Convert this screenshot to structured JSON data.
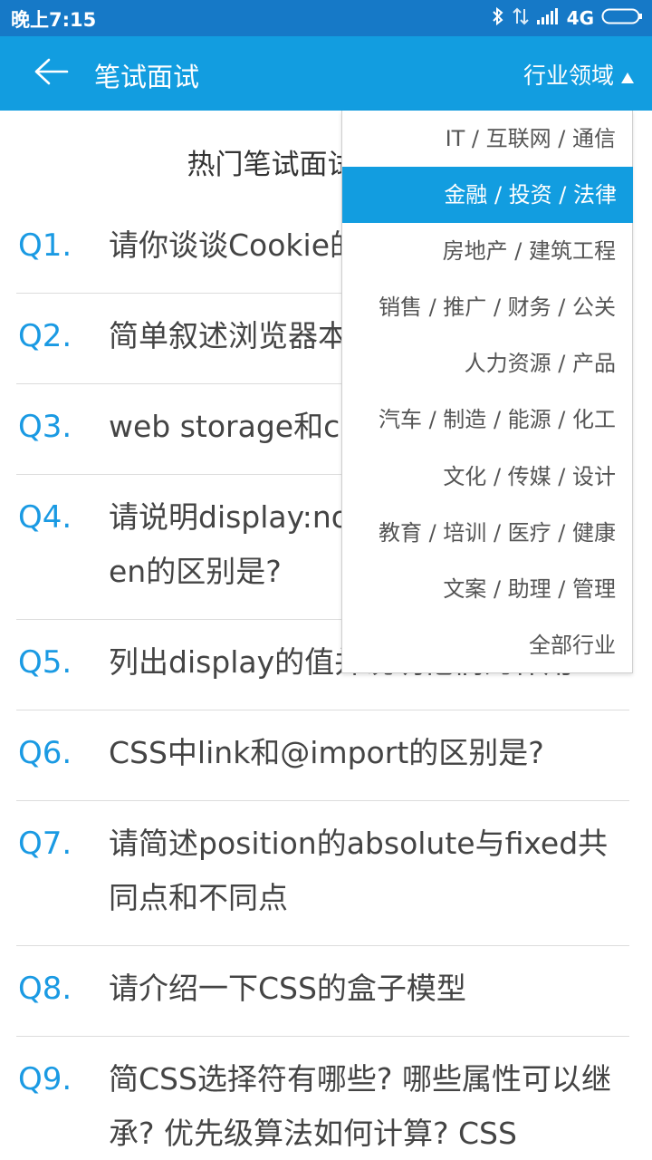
{
  "status_bar": {
    "time": "晚上7:15",
    "network": "4G",
    "icons": [
      "bluetooth-icon",
      "data-transfer-icon",
      "signal-icon",
      "battery-icon"
    ]
  },
  "app_bar": {
    "title": "笔试面试",
    "industry_label": "行业领域",
    "back_icon": "arrow-left-icon"
  },
  "section": {
    "title": "热门笔试面试题"
  },
  "questions": [
    {
      "num": "Q1.",
      "text": "请你谈谈Cookie的优缺点"
    },
    {
      "num": "Q2.",
      "text": "简单叙述浏览器本地存储"
    },
    {
      "num": "Q3.",
      "text": "web storage和cookie的区别"
    },
    {
      "num": "Q4.",
      "text": "请说明display:none与visibility:hidden的区别是?"
    },
    {
      "num": "Q5.",
      "text": "列出display的值并说明他们的作用"
    },
    {
      "num": "Q6.",
      "text": "CSS中link和@import的区别是?"
    },
    {
      "num": "Q7.",
      "text": "请简述position的absolute与fixed共同点和不同点"
    },
    {
      "num": "Q8.",
      "text": "请介绍一下CSS的盒子模型"
    },
    {
      "num": "Q9.",
      "text": "简CSS选择符有哪些? 哪些属性可以继承? 优先级算法如何计算? CSS"
    }
  ],
  "industry_menu": {
    "selected_index": 1,
    "items": [
      "IT / 互联网 / 通信",
      "金融 / 投资 / 法律",
      "房地产 / 建筑工程",
      "销售 / 推广 / 财务 / 公关",
      "人力资源 / 产品",
      "汽车 / 制造 / 能源 / 化工",
      "文化 / 传媒 / 设计",
      "教育 / 培训 / 医疗 / 健康",
      "文案 / 助理 / 管理",
      "全部行业"
    ]
  },
  "colors": {
    "status_bar": "#1679c7",
    "app_bar": "#129de0",
    "accent": "#1a9ae3",
    "selected_item": "#129de0"
  }
}
